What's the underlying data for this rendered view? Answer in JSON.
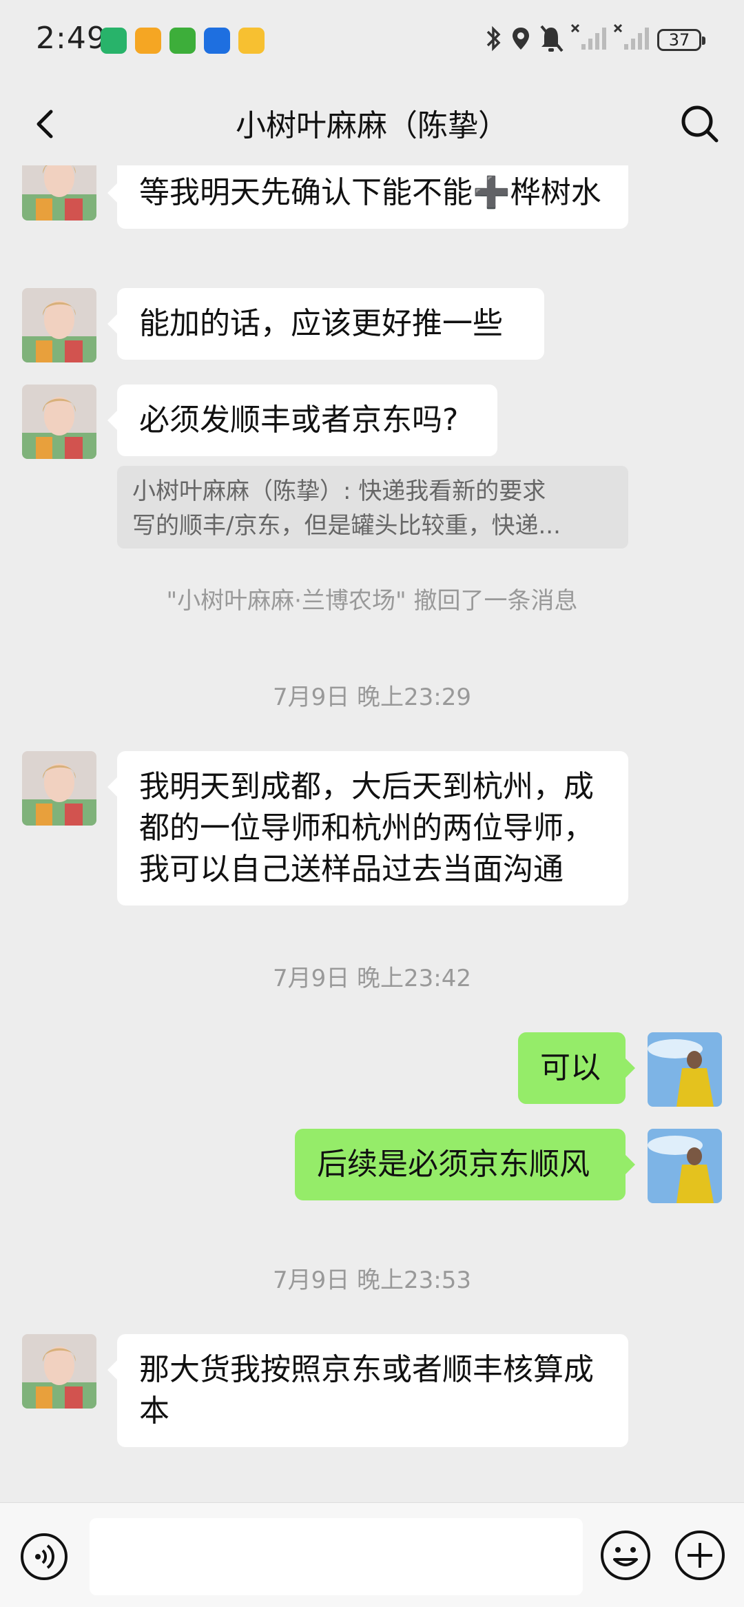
{
  "status_bar": {
    "time": "2:49",
    "battery": "37"
  },
  "header": {
    "title": "小树叶麻麻（陈挚）"
  },
  "messages": [
    {
      "text": "等我明天先确认下能不能➕桦树水"
    },
    {
      "text": "能加的话，应该更好推一些"
    },
    {
      "text": "必须发顺丰或者京东吗?"
    },
    {
      "quote_line1": "小树叶麻麻（陈挚）: 快递我看新的要求",
      "quote_line2": "写的顺丰/京东，但是罐头比较重，快递..."
    },
    {
      "recall": "\"小树叶麻麻·兰博农场\" 撤回了一条消息"
    },
    {
      "timestamp": "7月9日 晚上23:29"
    },
    {
      "text": "我明天到成都，大后天到杭州，成都的一位导师和杭州的两位导师，我可以自己送样品过去当面沟通"
    },
    {
      "timestamp": "7月9日 晚上23:42"
    },
    {
      "text": "可以"
    },
    {
      "text": "后续是必须京东顺风"
    },
    {
      "timestamp": "7月9日 晚上23:53"
    },
    {
      "text": "那大货我按照京东或者顺丰核算成本"
    }
  ],
  "colors": {
    "background": "#ededed",
    "my_bubble": "#95ec69",
    "other_bubble": "#ffffff"
  },
  "icons": {
    "back": "chevron-left-icon",
    "search": "search-icon",
    "voice": "voice-icon",
    "emoji": "emoji-icon",
    "plus": "plus-icon"
  }
}
